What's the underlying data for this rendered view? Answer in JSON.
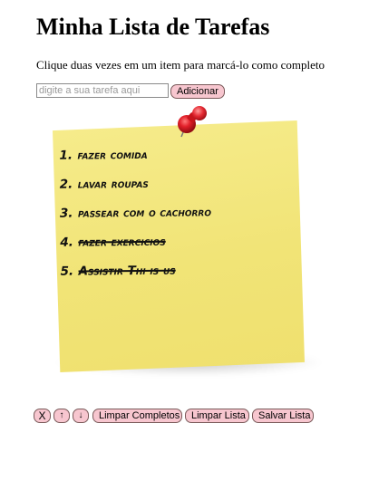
{
  "header": {
    "title": "Minha Lista de Tarefas",
    "instructions": "Clique duas vezes em um item para marcá-lo como completo"
  },
  "input": {
    "placeholder": "digite a sua tarefa aqui",
    "value": "",
    "add_label": "Adicionar"
  },
  "tasks": [
    {
      "number": "1.",
      "text": "fazer comida",
      "done": false
    },
    {
      "number": "2.",
      "text": "lavar roupas",
      "done": false
    },
    {
      "number": "3.",
      "text": "passear com o cachorro",
      "done": false
    },
    {
      "number": "4.",
      "text": "fazer exercicios",
      "done": true
    },
    {
      "number": "5.",
      "text": "Assistir Thi is us",
      "done": true
    }
  ],
  "toolbar": {
    "delete_label": "X",
    "up_label": "↑",
    "down_label": "↓",
    "clear_completed_label": "Limpar Completos",
    "clear_list_label": "Limpar Lista",
    "save_list_label": "Salvar Lista"
  },
  "colors": {
    "note": "#f1e477",
    "pin": "#e2202a",
    "button": "#f7c6cf"
  },
  "icons": {
    "pin": "push-pin-icon"
  }
}
